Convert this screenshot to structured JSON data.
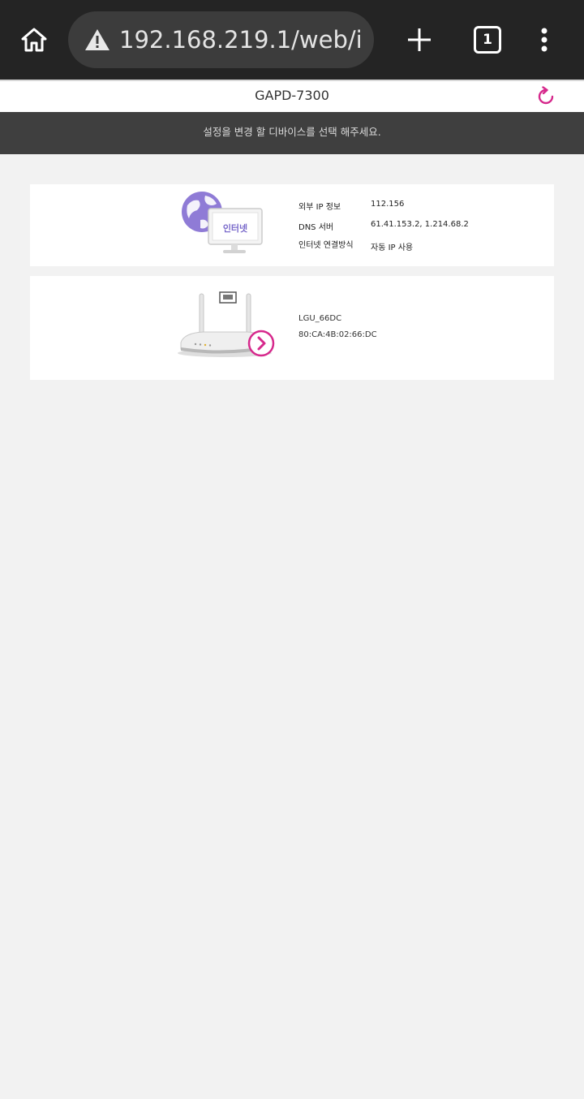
{
  "browser": {
    "url": "192.168.219.1/web/i",
    "tab_count": "1",
    "icons": {
      "home": "home-icon",
      "warning": "warning-icon",
      "new_tab": "plus-icon",
      "tabs": "tab-count-icon",
      "menu": "more-vert-icon"
    }
  },
  "header": {
    "title": "GAPD-7300",
    "refresh_icon": "refresh-icon",
    "accent_color": "#d6298c"
  },
  "notice": {
    "text": "설정을 변경 할 디바이스를 선택 해주세요."
  },
  "internet_card": {
    "illustration_label": "인터넷",
    "rows": [
      {
        "label": "외부 IP 정보",
        "value": "112.156"
      },
      {
        "label": "DNS 서버",
        "value": "61.41.153.2, 1.214.68.2"
      },
      {
        "label": "인터넷 연결방식",
        "value": "자동 IP 사용"
      }
    ]
  },
  "device_card": {
    "name": "LGU_66DC",
    "mac": "80:CA:4B:02:66:DC",
    "icon": "router-icon",
    "action_icon": "chevron-right-circle-icon"
  }
}
